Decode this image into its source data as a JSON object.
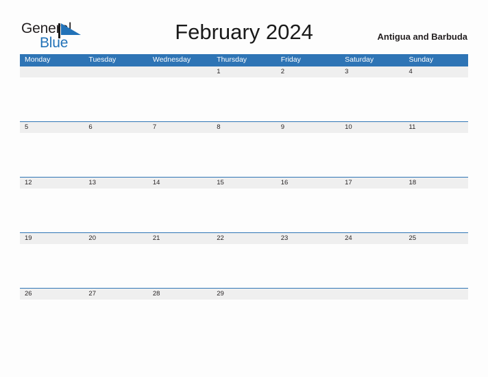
{
  "brand": {
    "name_part1": "General",
    "name_part2": "Blue",
    "flag_icon": "blue-flag-triangle",
    "color_primary": "#2272b8",
    "color_text": "#231f20"
  },
  "header": {
    "title": "February 2024",
    "country": "Antigua and Barbuda"
  },
  "calendar": {
    "month": "February",
    "year": "2024",
    "first_day_of_week": "Monday",
    "header_color": "#2e74b5",
    "date_strip_color": "#efefef",
    "weekdays": [
      {
        "label": "Monday"
      },
      {
        "label": "Tuesday"
      },
      {
        "label": "Wednesday"
      },
      {
        "label": "Thursday"
      },
      {
        "label": "Friday"
      },
      {
        "label": "Saturday"
      },
      {
        "label": "Sunday"
      }
    ],
    "weeks": [
      {
        "days": [
          "",
          "",
          "",
          "1",
          "2",
          "3",
          "4"
        ]
      },
      {
        "days": [
          "5",
          "6",
          "7",
          "8",
          "9",
          "10",
          "11"
        ]
      },
      {
        "days": [
          "12",
          "13",
          "14",
          "15",
          "16",
          "17",
          "18"
        ]
      },
      {
        "days": [
          "19",
          "20",
          "21",
          "22",
          "23",
          "24",
          "25"
        ]
      },
      {
        "days": [
          "26",
          "27",
          "28",
          "29",
          "",
          "",
          ""
        ]
      }
    ]
  }
}
